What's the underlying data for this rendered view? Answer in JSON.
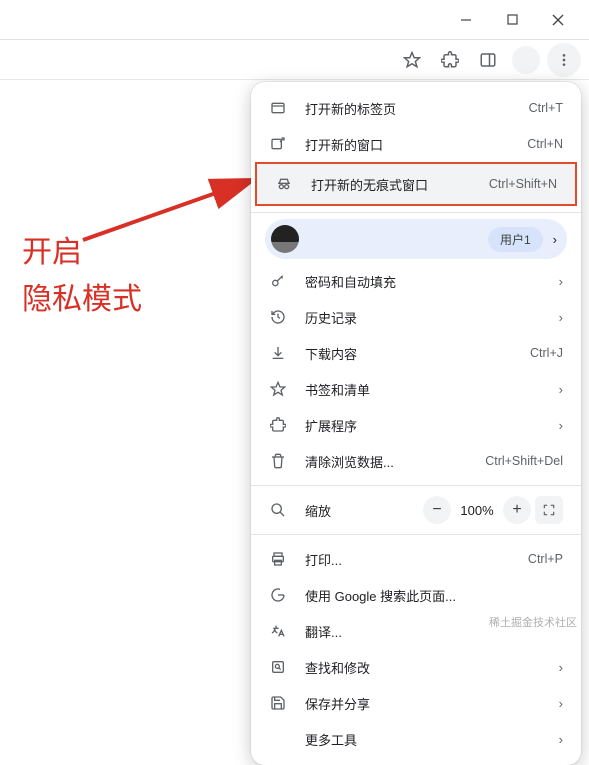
{
  "annotation": {
    "line1": "开启",
    "line2": "隐私模式"
  },
  "menu": {
    "new_tab": {
      "label": "打开新的标签页",
      "shortcut": "Ctrl+T"
    },
    "new_window": {
      "label": "打开新的窗口",
      "shortcut": "Ctrl+N"
    },
    "new_incognito": {
      "label": "打开新的无痕式窗口",
      "shortcut": "Ctrl+Shift+N"
    },
    "profile": {
      "chip": "用户1"
    },
    "passwords": {
      "label": "密码和自动填充"
    },
    "history": {
      "label": "历史记录"
    },
    "downloads": {
      "label": "下载内容",
      "shortcut": "Ctrl+J"
    },
    "bookmarks": {
      "label": "书签和清单"
    },
    "extensions": {
      "label": "扩展程序"
    },
    "clear_data": {
      "label": "清除浏览数据...",
      "shortcut": "Ctrl+Shift+Del"
    },
    "zoom": {
      "label": "缩放",
      "percent": "100%"
    },
    "print": {
      "label": "打印...",
      "shortcut": "Ctrl+P"
    },
    "google_search": {
      "label": "使用 Google 搜索此页面..."
    },
    "translate": {
      "label": "翻译..."
    },
    "find_edit": {
      "label": "查找和修改"
    },
    "save_share": {
      "label": "保存并分享"
    },
    "more_tools": {
      "label": "更多工具"
    }
  },
  "watermark": "稀土掘金技术社区"
}
